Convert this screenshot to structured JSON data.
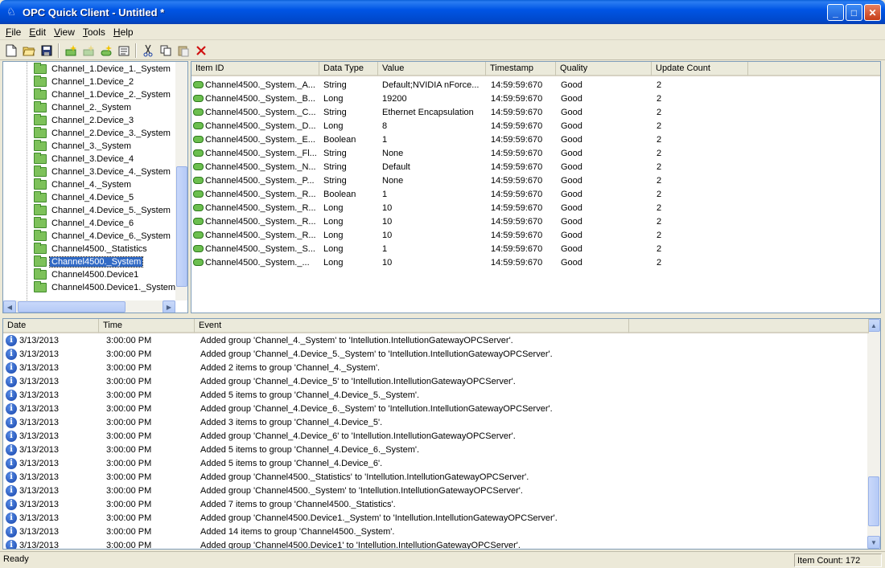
{
  "window": {
    "title": "OPC Quick Client - Untitled *",
    "minimize": "_",
    "maximize": "□",
    "close": "✕"
  },
  "menu": [
    {
      "label_ul": "F",
      "label_rest": "ile"
    },
    {
      "label_ul": "E",
      "label_rest": "dit"
    },
    {
      "label_ul": "V",
      "label_rest": "iew"
    },
    {
      "label_ul": "T",
      "label_rest": "ools"
    },
    {
      "label_ul": "H",
      "label_rest": "elp"
    }
  ],
  "toolbar_icons": [
    "new-file-icon",
    "open-folder-icon",
    "save-icon",
    "new-server-icon",
    "new-group-icon",
    "new-item-icon",
    "properties-icon",
    "cut-icon",
    "copy-icon",
    "paste-icon",
    "delete-icon"
  ],
  "tree": {
    "items": [
      "Channel_1.Device_1._System",
      "Channel_1.Device_2",
      "Channel_1.Device_2._System",
      "Channel_2._System",
      "Channel_2.Device_3",
      "Channel_2.Device_3._System",
      "Channel_3._System",
      "Channel_3.Device_4",
      "Channel_3.Device_4._System",
      "Channel_4._System",
      "Channel_4.Device_5",
      "Channel_4.Device_5._System",
      "Channel_4.Device_6",
      "Channel_4.Device_6._System",
      "Channel4500._Statistics",
      "Channel4500._System",
      "Channel4500.Device1",
      "Channel4500.Device1._System"
    ],
    "selected_index": 15
  },
  "items_table": {
    "columns": [
      "Item ID",
      "Data Type",
      "Value",
      "Timestamp",
      "Quality",
      "Update Count"
    ],
    "rows": [
      [
        "Channel4500._System._A...",
        "String",
        "Default;NVIDIA nForce...",
        "14:59:59:670",
        "Good",
        "2"
      ],
      [
        "Channel4500._System._B...",
        "Long",
        "19200",
        "14:59:59:670",
        "Good",
        "2"
      ],
      [
        "Channel4500._System._C...",
        "String",
        "Ethernet Encapsulation",
        "14:59:59:670",
        "Good",
        "2"
      ],
      [
        "Channel4500._System._D...",
        "Long",
        "8",
        "14:59:59:670",
        "Good",
        "2"
      ],
      [
        "Channel4500._System._E...",
        "Boolean",
        "1",
        "14:59:59:670",
        "Good",
        "2"
      ],
      [
        "Channel4500._System._Fl...",
        "String",
        "None",
        "14:59:59:670",
        "Good",
        "2"
      ],
      [
        "Channel4500._System._N...",
        "String",
        "Default",
        "14:59:59:670",
        "Good",
        "2"
      ],
      [
        "Channel4500._System._P...",
        "String",
        "None",
        "14:59:59:670",
        "Good",
        "2"
      ],
      [
        "Channel4500._System._R...",
        "Boolean",
        "1",
        "14:59:59:670",
        "Good",
        "2"
      ],
      [
        "Channel4500._System._R...",
        "Long",
        "10",
        "14:59:59:670",
        "Good",
        "2"
      ],
      [
        "Channel4500._System._R...",
        "Long",
        "10",
        "14:59:59:670",
        "Good",
        "2"
      ],
      [
        "Channel4500._System._R...",
        "Long",
        "10",
        "14:59:59:670",
        "Good",
        "2"
      ],
      [
        "Channel4500._System._S...",
        "Long",
        "1",
        "14:59:59:670",
        "Good",
        "2"
      ],
      [
        "Channel4500._System._...",
        "Long",
        "10",
        "14:59:59:670",
        "Good",
        "2"
      ]
    ]
  },
  "event_log": {
    "columns": [
      "Date",
      "Time",
      "Event"
    ],
    "rows": [
      [
        "3/13/2013",
        "3:00:00 PM",
        "Added group 'Channel_4._System' to 'Intellution.IntellutionGatewayOPCServer'."
      ],
      [
        "3/13/2013",
        "3:00:00 PM",
        "Added group 'Channel_4.Device_5._System' to 'Intellution.IntellutionGatewayOPCServer'."
      ],
      [
        "3/13/2013",
        "3:00:00 PM",
        "Added 2 items to group 'Channel_4._System'."
      ],
      [
        "3/13/2013",
        "3:00:00 PM",
        "Added group 'Channel_4.Device_5' to 'Intellution.IntellutionGatewayOPCServer'."
      ],
      [
        "3/13/2013",
        "3:00:00 PM",
        "Added 5 items to group 'Channel_4.Device_5._System'."
      ],
      [
        "3/13/2013",
        "3:00:00 PM",
        "Added group 'Channel_4.Device_6._System' to 'Intellution.IntellutionGatewayOPCServer'."
      ],
      [
        "3/13/2013",
        "3:00:00 PM",
        "Added 3 items to group 'Channel_4.Device_5'."
      ],
      [
        "3/13/2013",
        "3:00:00 PM",
        "Added group 'Channel_4.Device_6' to 'Intellution.IntellutionGatewayOPCServer'."
      ],
      [
        "3/13/2013",
        "3:00:00 PM",
        "Added 5 items to group 'Channel_4.Device_6._System'."
      ],
      [
        "3/13/2013",
        "3:00:00 PM",
        "Added 5 items to group 'Channel_4.Device_6'."
      ],
      [
        "3/13/2013",
        "3:00:00 PM",
        "Added group 'Channel4500._Statistics' to 'Intellution.IntellutionGatewayOPCServer'."
      ],
      [
        "3/13/2013",
        "3:00:00 PM",
        "Added group 'Channel4500._System' to 'Intellution.IntellutionGatewayOPCServer'."
      ],
      [
        "3/13/2013",
        "3:00:00 PM",
        "Added 7 items to group 'Channel4500._Statistics'."
      ],
      [
        "3/13/2013",
        "3:00:00 PM",
        "Added group 'Channel4500.Device1._System' to 'Intellution.IntellutionGatewayOPCServer'."
      ],
      [
        "3/13/2013",
        "3:00:00 PM",
        "Added 14 items to group 'Channel4500._System'."
      ],
      [
        "3/13/2013",
        "3:00:00 PM",
        "Added group 'Channel4500.Device1' to 'Intellution.IntellutionGatewayOPCServer'."
      ]
    ]
  },
  "status": {
    "left": "Ready",
    "right": "Item Count: 172"
  }
}
